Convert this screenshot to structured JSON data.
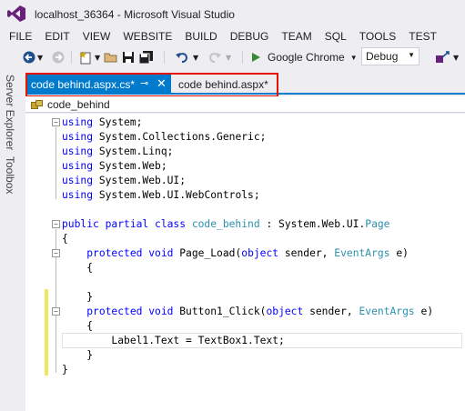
{
  "window": {
    "title": "localhost_36364 - Microsoft Visual Studio"
  },
  "menu": {
    "items": [
      "FILE",
      "EDIT",
      "VIEW",
      "WEBSITE",
      "BUILD",
      "DEBUG",
      "TEAM",
      "SQL",
      "TOOLS",
      "TEST"
    ]
  },
  "toolbar": {
    "run_target": "Google Chrome",
    "configuration": "Debug"
  },
  "side_tabs": {
    "server_explorer": "Server Explorer",
    "toolbox": "Toolbox"
  },
  "tabs": {
    "active_label": "code behind.aspx.cs*",
    "inactive_label": "code behind.aspx*"
  },
  "navbar": {
    "class_label": "code_behind"
  },
  "code": {
    "lines": [
      [
        [
          "kw",
          "using"
        ],
        [
          "tx",
          " System;"
        ]
      ],
      [
        [
          "kw",
          "using"
        ],
        [
          "tx",
          " System.Collections.Generic;"
        ]
      ],
      [
        [
          "kw",
          "using"
        ],
        [
          "tx",
          " System.Linq;"
        ]
      ],
      [
        [
          "kw",
          "using"
        ],
        [
          "tx",
          " System.Web;"
        ]
      ],
      [
        [
          "kw",
          "using"
        ],
        [
          "tx",
          " System.Web.UI;"
        ]
      ],
      [
        [
          "kw",
          "using"
        ],
        [
          "tx",
          " System.Web.UI.WebControls;"
        ]
      ],
      [
        [
          "tx",
          ""
        ]
      ],
      [
        [
          "kw",
          "public partial class "
        ],
        [
          "ty",
          "code_behind"
        ],
        [
          "tx",
          " : System.Web.UI."
        ],
        [
          "ty",
          "Page"
        ]
      ],
      [
        [
          "tx",
          "{"
        ]
      ],
      [
        [
          "tx",
          "    "
        ],
        [
          "kw",
          "protected void "
        ],
        [
          "tx",
          "Page_Load("
        ],
        [
          "kw",
          "object "
        ],
        [
          "tx",
          "sender, "
        ],
        [
          "ty",
          "EventArgs"
        ],
        [
          "tx",
          " e)"
        ]
      ],
      [
        [
          "tx",
          "    {"
        ]
      ],
      [
        [
          "tx",
          ""
        ]
      ],
      [
        [
          "tx",
          "    }"
        ]
      ],
      [
        [
          "tx",
          "    "
        ],
        [
          "kw",
          "protected void "
        ],
        [
          "tx",
          "Button1_Click("
        ],
        [
          "kw",
          "object "
        ],
        [
          "tx",
          "sender, "
        ],
        [
          "ty",
          "EventArgs"
        ],
        [
          "tx",
          " e)"
        ]
      ],
      [
        [
          "tx",
          "    {"
        ]
      ],
      [
        [
          "tx",
          "        Label1.Text = TextBox1.Text;"
        ]
      ],
      [
        [
          "tx",
          "    }"
        ]
      ],
      [
        [
          "tx",
          "}"
        ]
      ]
    ]
  },
  "colors": {
    "keyword": "#0000ff",
    "type": "#2b91af",
    "accent": "#007acc",
    "highlight_box": "#e51400",
    "change_bar": "#efe75f"
  }
}
